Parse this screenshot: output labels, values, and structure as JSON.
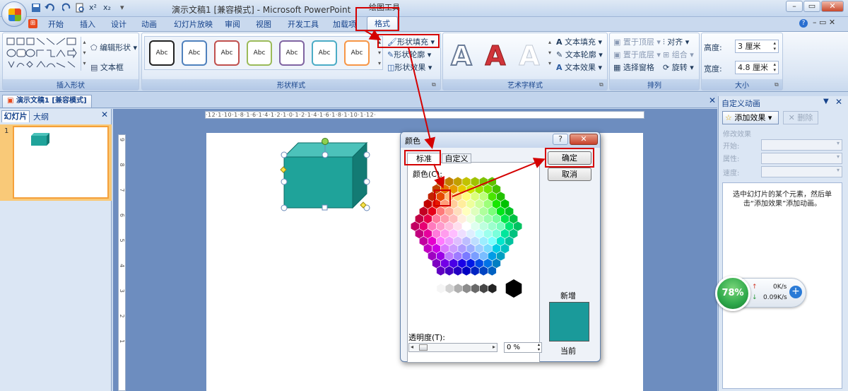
{
  "window": {
    "doc_title": "演示文稿1 [兼容模式] - Microsoft PowerPoint",
    "context_title": "绘图工具",
    "qa_items": [
      "x²",
      "x₂"
    ]
  },
  "tabs": [
    "开始",
    "插入",
    "设计",
    "动画",
    "幻灯片放映",
    "审阅",
    "视图",
    "开发工具",
    "加载项",
    "格式"
  ],
  "ribbon": {
    "insert_shapes": {
      "label": "插入形状",
      "edit_shape": "编辑形状",
      "text_box": "文本框"
    },
    "shape_styles": {
      "label": "形状样式",
      "style_text": "Abc",
      "fill": "形状填充",
      "outline": "形状轮廓",
      "effects": "形状效果",
      "style_colors": [
        "#222222",
        "#4f81bd",
        "#c0504d",
        "#9bbb59",
        "#8064a2",
        "#4bacc6",
        "#f79646"
      ]
    },
    "wordart": {
      "label": "艺术字样式",
      "glyph": "A",
      "text_fill": "文本填充",
      "text_outline": "文本轮廓",
      "text_effects": "文本效果"
    },
    "arrange": {
      "label": "排列",
      "bring_front": "置于顶层",
      "send_back": "置于底层",
      "selection_pane": "选择窗格",
      "align": "对齐",
      "group": "组合",
      "rotate": "旋转"
    },
    "size": {
      "label": "大小",
      "height_label": "高度:",
      "height_value": "3 厘米",
      "width_label": "宽度:",
      "width_value": "4.8 厘米"
    }
  },
  "doc_tab": "演示文稿1 [兼容模式]",
  "left_pane": {
    "tabs": [
      "幻灯片",
      "大纲"
    ],
    "slide_number": "1"
  },
  "ruler": {
    "h_text": "·12·1·10·1·8·1·6·1·4·1·2·1·0·1·2·1·4·1·6·1·8·1·10·1·12·",
    "v_text": "9 8 7 6 5 4 3 2 1"
  },
  "shape_color": "#1fa39a",
  "right_pane": {
    "title": "自定义动画",
    "add_effect": "添加效果",
    "delete": "删除",
    "modify_label": "修改效果",
    "start": "开始:",
    "property": "属性:",
    "speed": "速度:",
    "hint": "选中幻灯片的某个元素，然后单击“添加效果”添加动画。"
  },
  "net_widget": {
    "percent": "78%",
    "up": "0K/s",
    "down": "0.09K/s"
  },
  "dialog": {
    "title": "颜色",
    "help": "?",
    "tab_standard": "标准",
    "tab_custom": "自定义",
    "colors_label": "颜色(C):",
    "ok": "确定",
    "cancel": "取消",
    "transparency_label": "透明度(T):",
    "transparency_value": "0 %",
    "new_label": "新增",
    "current_label": "当前",
    "new_color": "#1a9a9a",
    "current_color": "#1a9a9a"
  }
}
